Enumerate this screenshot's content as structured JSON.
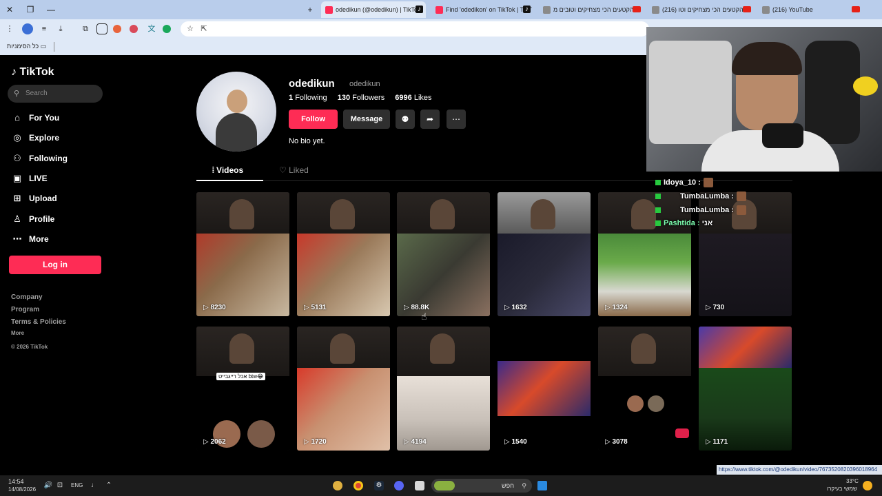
{
  "browser": {
    "tabs": [
      {
        "label": "odedikun (@odedikun) | TikTok",
        "active": true
      },
      {
        "label": "Find 'odedikon' on TikTok | TikT",
        "active": false
      },
      {
        "label": "הקטעים הכי מצחיקים וטובים מ",
        "active": false
      },
      {
        "label": "(216) הקטעים הכי מצחיקים וטו",
        "active": false
      },
      {
        "label": "(216) YouTube",
        "active": false
      }
    ],
    "bookmarks_label": "כל הסימניות"
  },
  "sidebar": {
    "logo": "TikTok",
    "search_placeholder": "Search",
    "nav": [
      {
        "label": "For You",
        "icon": "home-icon"
      },
      {
        "label": "Explore",
        "icon": "compass-icon"
      },
      {
        "label": "Following",
        "icon": "following-icon"
      },
      {
        "label": "LIVE",
        "icon": "live-icon"
      },
      {
        "label": "Upload",
        "icon": "upload-icon"
      },
      {
        "label": "Profile",
        "icon": "profile-icon"
      },
      {
        "label": "More",
        "icon": "more-icon"
      }
    ],
    "login_label": "Log in",
    "footer": [
      "Company",
      "Program",
      "Terms & Policies",
      "More",
      "© 2026 TikTok"
    ]
  },
  "profile": {
    "username": "odedikun",
    "handle": "odedikun",
    "following_count": "1",
    "following_label": "Following",
    "followers_count": "130",
    "followers_label": "Followers",
    "likes_count": "6996",
    "likes_label": "Likes",
    "follow_label": "Follow",
    "message_label": "Message",
    "bio": "No bio yet.",
    "tab_videos": "Videos",
    "tab_liked": "Liked"
  },
  "videos": [
    {
      "views": "8230"
    },
    {
      "views": "5131"
    },
    {
      "views": "88.8K"
    },
    {
      "views": "1632"
    },
    {
      "views": "1324"
    },
    {
      "views": "730"
    },
    {
      "views": "2062",
      "caption": "אכל רייגבייט btw😂"
    },
    {
      "views": "1720"
    },
    {
      "views": "4194"
    },
    {
      "views": "1540"
    },
    {
      "views": "3078"
    },
    {
      "views": "1171"
    }
  ],
  "chat": [
    {
      "user": "Idoya_10 :",
      "color": "#ffffff"
    },
    {
      "user": "TumbaLumba :",
      "color": "#ffffff"
    },
    {
      "user": "TumbaLumba :",
      "color": "#ffffff"
    },
    {
      "user": "Pashtida :",
      "message": "אני",
      "color": "#7dffb0"
    }
  ],
  "status": {
    "url_tooltip": "https://www.tiktok.com/@odedikun/video/7673520820396018964"
  },
  "taskbar": {
    "time": "14:54",
    "date": "14/08/2026",
    "lang": "ENG",
    "search_label": "חפש",
    "temperature": "33°C",
    "weather": "שמשי בעיקרו"
  }
}
